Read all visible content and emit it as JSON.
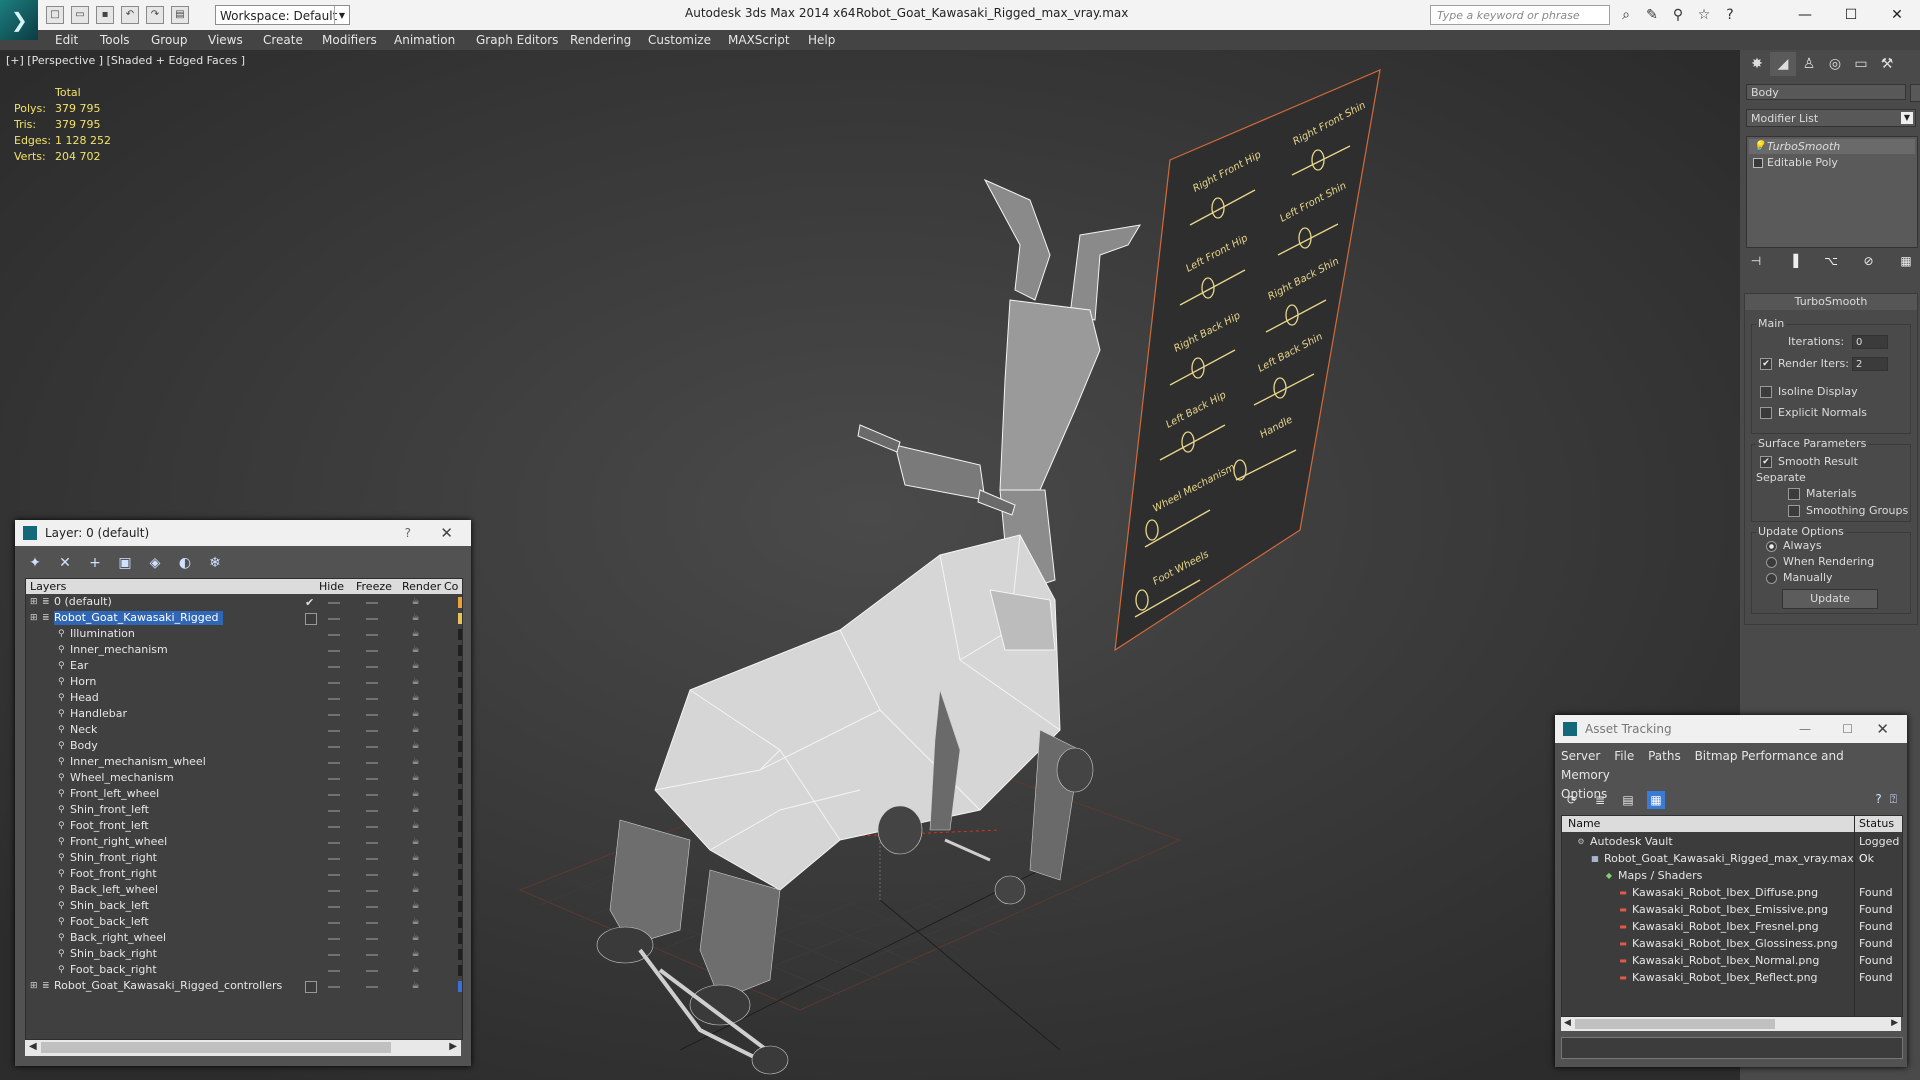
{
  "window": {
    "app_title": "Autodesk 3ds Max  2014 x64",
    "file_title": "Robot_Goat_Kawasaki_Rigged_max_vray.max",
    "workspace": "Workspace: Default",
    "search_placeholder": "Type a keyword or phrase",
    "logo_glyph": "❯"
  },
  "menu": [
    "Edit",
    "Tools",
    "Group",
    "Views",
    "Create",
    "Modifiers",
    "Animation",
    "Graph Editors",
    "Rendering",
    "Customize",
    "MAXScript",
    "Help"
  ],
  "viewport": {
    "label": "[+] [Perspective ] [Shaded + Edged Faces ]",
    "stats": {
      "header": "Total",
      "rows": [
        {
          "label": "Polys:",
          "value": "379 795"
        },
        {
          "label": "Tris:",
          "value": "379 795"
        },
        {
          "label": "Edges:",
          "value": "1 128 252"
        },
        {
          "label": "Verts:",
          "value": "204 702"
        }
      ]
    },
    "board_labels": [
      "Right Front Hip",
      "Right Front Shin",
      "Left Front Hip",
      "Left Front Shin",
      "Right Back Hip",
      "Right Back Shin",
      "Left Back Hip",
      "Left Back Shin",
      "Wheel Mechanism",
      "Handle",
      "Foot Wheels"
    ]
  },
  "layer_dialog": {
    "title": "Layer: 0 (default)",
    "help": "?",
    "columns": [
      "Layers",
      "Hide",
      "Freeze",
      "Render",
      "Co"
    ],
    "rows": [
      {
        "name": "0 (default)",
        "level": 0,
        "type": "layer",
        "check": "✔",
        "color": "#e8a33a"
      },
      {
        "name": "Robot_Goat_Kawasaki_Rigged",
        "level": 0,
        "type": "layer",
        "selected": true,
        "box": true,
        "color": "#e8c25a"
      },
      {
        "name": "Illumination",
        "level": 1,
        "type": "obj"
      },
      {
        "name": "Inner_mechanism",
        "level": 1,
        "type": "obj"
      },
      {
        "name": "Ear",
        "level": 1,
        "type": "obj"
      },
      {
        "name": "Horn",
        "level": 1,
        "type": "obj"
      },
      {
        "name": "Head",
        "level": 1,
        "type": "obj"
      },
      {
        "name": "Handlebar",
        "level": 1,
        "type": "obj"
      },
      {
        "name": "Neck",
        "level": 1,
        "type": "obj"
      },
      {
        "name": "Body",
        "level": 1,
        "type": "obj"
      },
      {
        "name": "Inner_mechanism_wheel",
        "level": 1,
        "type": "obj"
      },
      {
        "name": "Wheel_mechanism",
        "level": 1,
        "type": "obj"
      },
      {
        "name": "Front_left_wheel",
        "level": 1,
        "type": "obj"
      },
      {
        "name": "Shin_front_left",
        "level": 1,
        "type": "obj"
      },
      {
        "name": "Foot_front_left",
        "level": 1,
        "type": "obj"
      },
      {
        "name": "Front_right_wheel",
        "level": 1,
        "type": "obj"
      },
      {
        "name": "Shin_front_right",
        "level": 1,
        "type": "obj"
      },
      {
        "name": "Foot_front_right",
        "level": 1,
        "type": "obj"
      },
      {
        "name": "Back_left_wheel",
        "level": 1,
        "type": "obj"
      },
      {
        "name": "Shin_back_left",
        "level": 1,
        "type": "obj"
      },
      {
        "name": "Foot_back_left",
        "level": 1,
        "type": "obj"
      },
      {
        "name": "Back_right_wheel",
        "level": 1,
        "type": "obj"
      },
      {
        "name": "Shin_back_right",
        "level": 1,
        "type": "obj"
      },
      {
        "name": "Foot_back_right",
        "level": 1,
        "type": "obj"
      },
      {
        "name": "Robot_Goat_Kawasaki_Rigged_controllers",
        "level": 0,
        "type": "layer",
        "box": true,
        "color": "#3b6fd6"
      }
    ]
  },
  "command_panel": {
    "object_name": "Body",
    "modifier_list": "Modifier List",
    "stack": [
      {
        "label": "TurboSmooth",
        "selected": true
      },
      {
        "label": "Editable Poly",
        "selected": false
      }
    ],
    "rollout": {
      "title": "TurboSmooth",
      "main": "Main",
      "iterations_label": "Iterations:",
      "iterations": "0",
      "render_iters_label": "Render Iters:",
      "render_iters": "2",
      "isoline": "Isoline Display",
      "explicit": "Explicit Normals",
      "surface": "Surface Parameters",
      "smooth_result": "Smooth Result",
      "separate": "Separate",
      "materials": "Materials",
      "smoothing_groups": "Smoothing Groups",
      "update_options": "Update Options",
      "always": "Always",
      "when_rendering": "When Rendering",
      "manually": "Manually",
      "update": "Update"
    }
  },
  "asset_tracking": {
    "title": "Asset Tracking",
    "menus": [
      "Server",
      "File",
      "Paths",
      "Bitmap Performance and Memory",
      "Options"
    ],
    "columns": [
      "Name",
      "Status"
    ],
    "rows": [
      {
        "name": "Autodesk Vault",
        "status": "Logged O",
        "indent": 1,
        "icon": "vault"
      },
      {
        "name": "Robot_Goat_Kawasaki_Rigged_max_vray.max",
        "status": "Ok",
        "indent": 2,
        "icon": "max"
      },
      {
        "name": "Maps / Shaders",
        "status": "",
        "indent": 3,
        "icon": "maps"
      },
      {
        "name": "Kawasaki_Robot_Ibex_Diffuse.png",
        "status": "Found",
        "indent": 4,
        "icon": "png"
      },
      {
        "name": "Kawasaki_Robot_Ibex_Emissive.png",
        "status": "Found",
        "indent": 4,
        "icon": "png"
      },
      {
        "name": "Kawasaki_Robot_Ibex_Fresnel.png",
        "status": "Found",
        "indent": 4,
        "icon": "png"
      },
      {
        "name": "Kawasaki_Robot_Ibex_Glossiness.png",
        "status": "Found",
        "indent": 4,
        "icon": "png"
      },
      {
        "name": "Kawasaki_Robot_Ibex_Normal.png",
        "status": "Found",
        "indent": 4,
        "icon": "png"
      },
      {
        "name": "Kawasaki_Robot_Ibex_Reflect.png",
        "status": "Found",
        "indent": 4,
        "icon": "png"
      }
    ]
  },
  "colors": {
    "selection": "#2f66b5",
    "stats": "#f2e26a",
    "board": "#d26a3a"
  }
}
